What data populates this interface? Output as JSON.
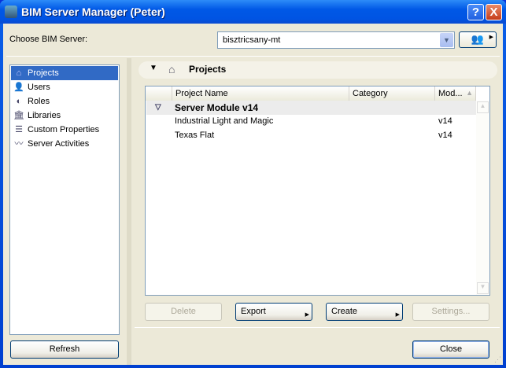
{
  "window": {
    "title": "BIM Server Manager (Peter)",
    "help": "?",
    "close": "X"
  },
  "server": {
    "label": "Choose BIM Server:",
    "value": "bisztricsany-mt"
  },
  "sidebar": {
    "items": [
      {
        "label": "Projects",
        "icon": "house-icon"
      },
      {
        "label": "Users",
        "icon": "user-icon"
      },
      {
        "label": "Roles",
        "icon": "roles-icon"
      },
      {
        "label": "Libraries",
        "icon": "library-icon"
      },
      {
        "label": "Custom Properties",
        "icon": "properties-icon"
      },
      {
        "label": "Server Activities",
        "icon": "activity-icon"
      }
    ],
    "refresh": "Refresh"
  },
  "main": {
    "section_title": "Projects",
    "columns": [
      "Project Name",
      "Category",
      "Mod..."
    ],
    "group": "Server Module v14",
    "rows": [
      {
        "name": "Industrial Light and Magic",
        "category": "",
        "module": "v14"
      },
      {
        "name": "Texas Flat",
        "category": "",
        "module": "v14"
      }
    ],
    "buttons": {
      "delete": "Delete",
      "export": "Export",
      "create": "Create",
      "settings": "Settings...",
      "close": "Close"
    }
  }
}
